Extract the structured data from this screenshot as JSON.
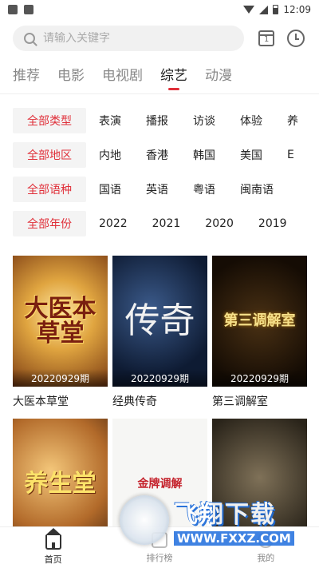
{
  "status_bar": {
    "time": "12:09"
  },
  "search": {
    "placeholder": "请输入关键字"
  },
  "tabs": [
    {
      "label": "推荐",
      "active": false
    },
    {
      "label": "电影",
      "active": false
    },
    {
      "label": "电视剧",
      "active": false
    },
    {
      "label": "综艺",
      "active": true
    },
    {
      "label": "动漫",
      "active": false
    }
  ],
  "filters": {
    "type": {
      "head": "全部类型",
      "options": [
        "表演",
        "播报",
        "访谈",
        "体验",
        "养"
      ]
    },
    "region": {
      "head": "全部地区",
      "options": [
        "内地",
        "香港",
        "韩国",
        "美国",
        "E"
      ]
    },
    "language": {
      "head": "全部语种",
      "options": [
        "国语",
        "英语",
        "粤语",
        "闽南语"
      ]
    },
    "year": {
      "head": "全部年份",
      "options": [
        "2022",
        "2021",
        "2020",
        "2019"
      ]
    }
  },
  "shows": [
    {
      "title": "大医本草堂",
      "poster_text": "大医本草堂",
      "episode": "20220929期"
    },
    {
      "title": "经典传奇",
      "poster_text": "传奇",
      "episode": "20220929期"
    },
    {
      "title": "第三调解室",
      "poster_text": "第三调解室",
      "episode": "20220929期"
    },
    {
      "title": "",
      "poster_text": "养生堂",
      "episode": ""
    },
    {
      "title": "",
      "poster_text": "金牌调解",
      "episode": ""
    },
    {
      "title": "",
      "poster_text": "",
      "episode": ""
    }
  ],
  "watermark": {
    "big": "飞翔下载",
    "small": "WWW.FXXZ.COM"
  },
  "bottom_nav": [
    {
      "label": "首页",
      "active": true
    },
    {
      "label": "排行榜",
      "active": false
    },
    {
      "label": "我的",
      "active": false
    }
  ],
  "colors": {
    "accent": "#e0303a"
  }
}
